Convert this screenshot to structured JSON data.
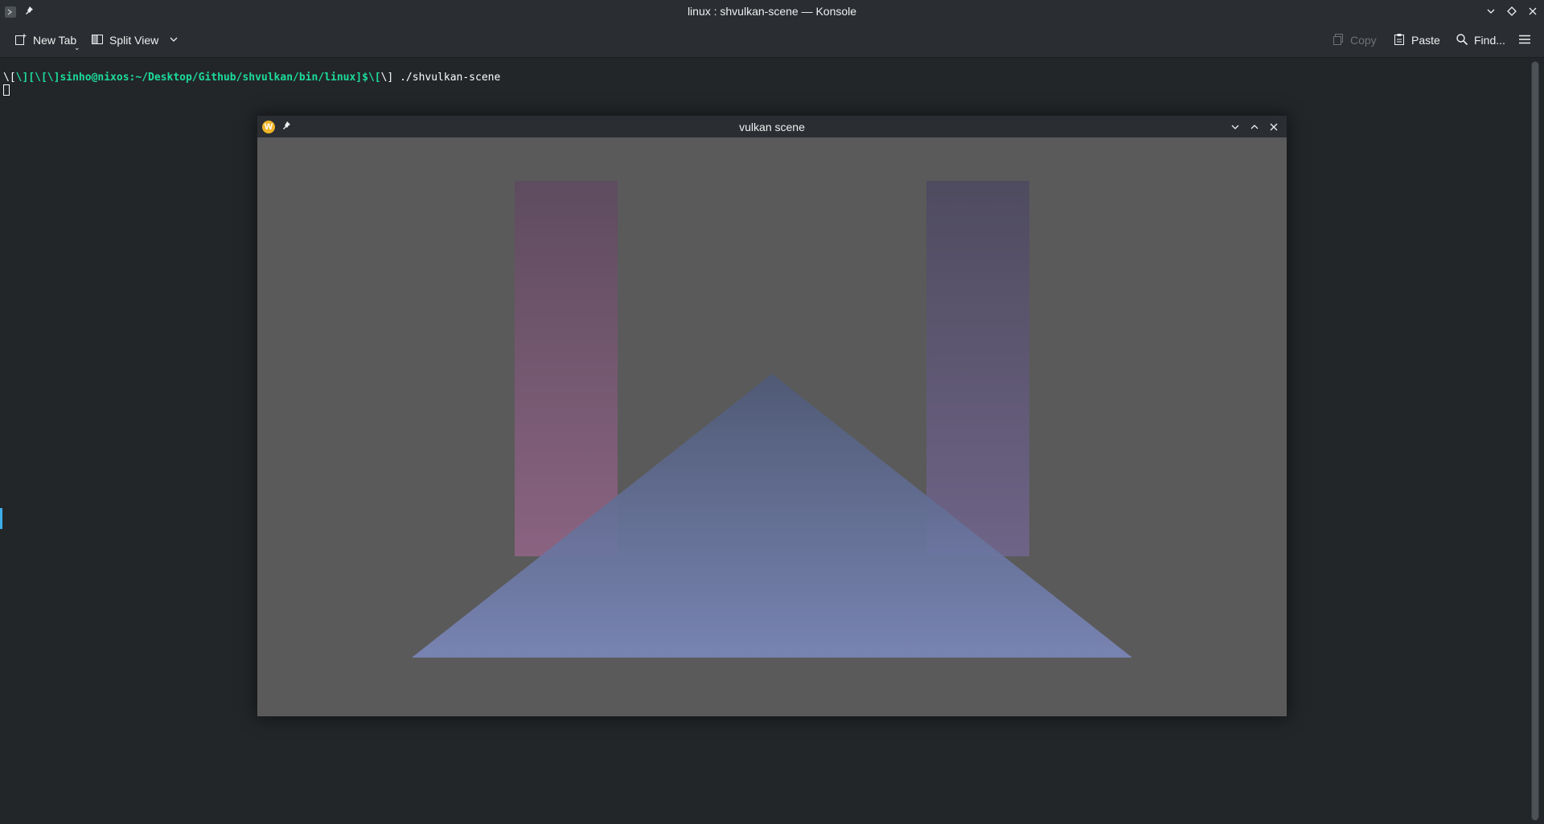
{
  "window": {
    "title": "linux : shvulkan-scene — Konsole"
  },
  "toolbar": {
    "new_tab_label": "New Tab",
    "split_view_label": "Split View",
    "copy_label": "Copy",
    "paste_label": "Paste",
    "find_label": "Find..."
  },
  "terminal": {
    "prompt_prefix": "\\[",
    "prompt_colored": "\\][\\[\\]sinho@nixos:~/Desktop/Github/shvulkan/bin/linux]$\\[",
    "prompt_suffix": "\\] ./shvulkan-scene"
  },
  "vulkan_window": {
    "title": "vulkan scene",
    "background": "#5a5a5a"
  },
  "colors": {
    "prompt_green": "#1cdc9a",
    "accent": "#3daee9",
    "triangle_top": "#4f5a77",
    "triangle_bottom": "#7a86b8",
    "left_bar_top": "#5e4c5f",
    "left_bar_bottom": "#8a6381",
    "right_bar_top": "#4f4b5f",
    "right_bar_bottom": "#6e6487"
  }
}
